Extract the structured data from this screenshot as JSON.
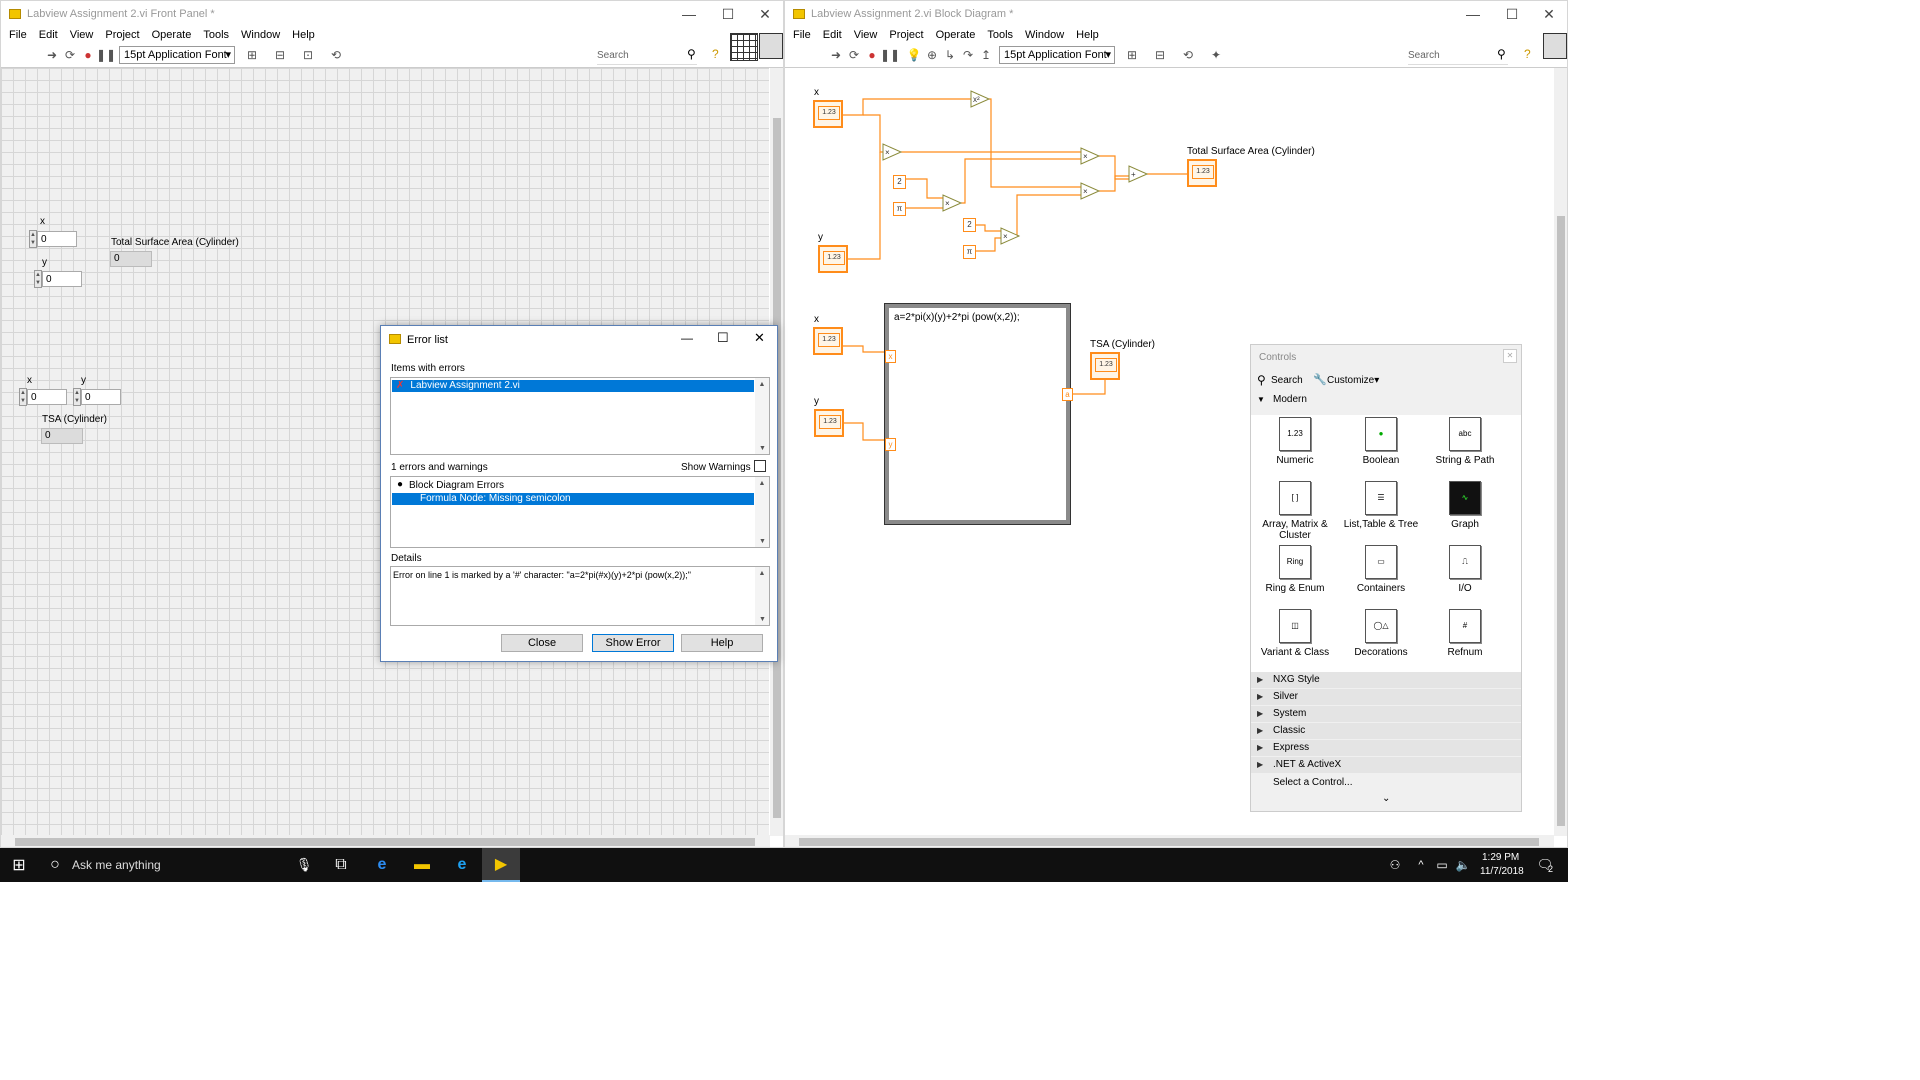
{
  "front_panel": {
    "title": "Labview Assignment 2.vi Front Panel *",
    "menu": [
      "File",
      "Edit",
      "View",
      "Project",
      "Operate",
      "Tools",
      "Window",
      "Help"
    ],
    "font": "15pt Application Font",
    "search_placeholder": "Search",
    "controls": [
      {
        "label": "x",
        "value": "0"
      },
      {
        "label": "y",
        "value": "0"
      },
      {
        "label": "x",
        "value": "0"
      },
      {
        "label": "y",
        "value": "0"
      }
    ],
    "indicators": [
      {
        "label": "Total Surface Area (Cylinder)",
        "value": "0"
      },
      {
        "label": "TSA (Cylinder)",
        "value": "0"
      }
    ]
  },
  "block_diagram": {
    "title": "Labview Assignment 2.vi Block Diagram *",
    "menu": [
      "File",
      "Edit",
      "View",
      "Project",
      "Operate",
      "Tools",
      "Window",
      "Help"
    ],
    "font": "15pt Application Font",
    "search_placeholder": "Search",
    "labels": {
      "x1": "x",
      "y1": "y",
      "x2": "x",
      "y2": "y",
      "tsa_long": "Total Surface Area (Cylinder)",
      "tsa_short": "TSA (Cylinder)"
    },
    "constants": {
      "two_a": "2",
      "pi_a": "π",
      "two_b": "2",
      "pi_b": "π"
    },
    "operators": {
      "square": "x²",
      "mult": "×",
      "add": "+"
    },
    "terminal_text": "1.23",
    "formula": "a=2*pi(x)(y)+2*pi (pow(x,2));",
    "formula_in_x": "x",
    "formula_in_y": "y",
    "formula_out": "a"
  },
  "error_dialog": {
    "title": "Error list",
    "items_label": "Items with errors",
    "item": "Labview Assignment 2.vi",
    "count_label": "1 errors and warnings",
    "show_warnings_label": "Show Warnings",
    "group": "Block Diagram Errors",
    "error": "Formula Node: Missing semicolon",
    "details_label": "Details",
    "details_text": "Error on line 1 is marked by a '#' character: \"a=2*pi(#x)(y)+2*pi (pow(x,2));\"",
    "buttons": {
      "close": "Close",
      "show_error": "Show Error",
      "help": "Help"
    }
  },
  "controls_palette": {
    "title": "Controls",
    "search": "Search",
    "customize": "Customize▾",
    "section": "Modern",
    "items": [
      "Numeric",
      "Boolean",
      "String & Path",
      "Array, Matrix & Cluster",
      "List,Table & Tree",
      "Graph",
      "Ring & Enum",
      "Containers",
      "I/O",
      "Variant & Class",
      "Decorations",
      "Refnum"
    ],
    "categories": [
      "NXG Style",
      "Silver",
      "System",
      "Classic",
      "Express",
      ".NET & ActiveX"
    ],
    "select_control": "Select a Control..."
  },
  "taskbar": {
    "search_placeholder": "Ask me anything",
    "time": "1:29 PM",
    "date": "11/7/2018",
    "notifications": "2"
  },
  "colors": {
    "accent": "#0078d7",
    "wire": "#ff8c1a",
    "taskbar": "#101010"
  }
}
